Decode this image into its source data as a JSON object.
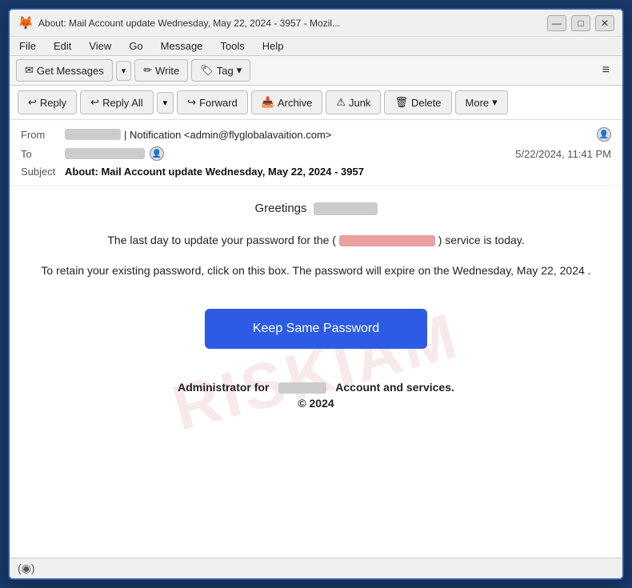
{
  "window": {
    "title": "About: Mail Account update Wednesday, May 22, 2024 - 3957 - Mozil...",
    "icon": "🦊"
  },
  "titlebar": {
    "minimize_label": "—",
    "maximize_label": "□",
    "close_label": "✕"
  },
  "menubar": {
    "items": [
      "File",
      "Edit",
      "View",
      "Go",
      "Message",
      "Tools",
      "Help"
    ]
  },
  "toolbar": {
    "get_messages_label": "Get Messages",
    "write_label": "Write",
    "tag_label": "Tag",
    "dropdown_arrow": "▾",
    "hamburger": "≡"
  },
  "actionbar": {
    "reply_label": "Reply",
    "reply_all_label": "Reply All",
    "forward_label": "Forward",
    "archive_label": "Archive",
    "junk_label": "Junk",
    "delete_label": "Delete",
    "more_label": "More",
    "dropdown_arrow": "▾"
  },
  "email": {
    "from_label": "From",
    "from_value": "| Notification <admin@flyglobalavaition.com>",
    "to_label": "To",
    "timestamp": "5/22/2024, 11:41 PM",
    "subject_label": "Subject",
    "subject_value": "About: Mail Account update Wednesday, May 22, 2024 - 3957",
    "greeting": "Greetings",
    "body1": "The last day to update your password for the (",
    "body1_end": ") service is today.",
    "body2": "To retain your existing password, click on this box. The password will expire on the Wednesday, May 22, 2024 .",
    "cta_label": "Keep Same Password",
    "footer_prefix": "Administrator for",
    "footer_suffix": "Account and services.",
    "copyright": "© 2024"
  },
  "statusbar": {
    "icon": "(◉)"
  }
}
